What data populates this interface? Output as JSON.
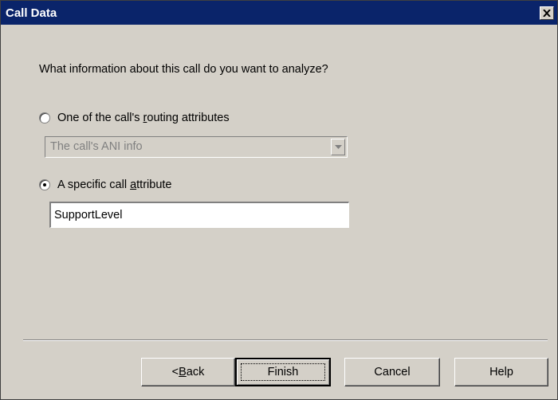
{
  "window": {
    "title": "Call Data"
  },
  "question": "What information about this call do you want to analyze?",
  "option_routing": {
    "label_before": "One of the call's ",
    "label_accel": "r",
    "label_after": "outing attributes",
    "selected": false
  },
  "routing_combo": {
    "value": "The call's ANI info",
    "enabled": false
  },
  "option_specific": {
    "label_before": "A specific call ",
    "label_accel": "a",
    "label_after": "ttribute",
    "selected": true
  },
  "attribute_field": {
    "value": "SupportLevel"
  },
  "buttons": {
    "back_prefix": "< ",
    "back_accel": "B",
    "back_rest": "ack",
    "finish": "Finish",
    "cancel": "Cancel",
    "help": "Help"
  },
  "icons": {
    "close": "close-icon",
    "dropdown": "chevron-down-icon"
  },
  "colors": {
    "titlebar": "#0a246a",
    "face": "#d4d0c8"
  }
}
